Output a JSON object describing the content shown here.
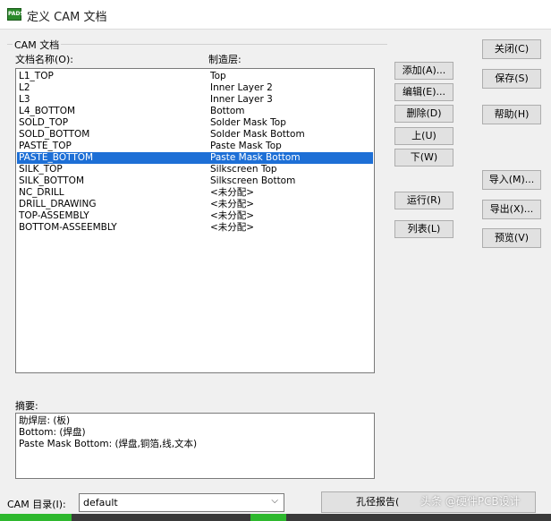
{
  "window": {
    "icon_text": "PADS",
    "title": "定义 CAM 文档"
  },
  "group": {
    "label": "CAM 文档"
  },
  "columns": {
    "name": "文档名称(O):",
    "layer": "制造层:"
  },
  "documents": [
    {
      "name": "L1_TOP",
      "layer": "Top",
      "selected": false
    },
    {
      "name": "L2",
      "layer": "Inner Layer 2",
      "selected": false
    },
    {
      "name": "L3",
      "layer": "Inner Layer 3",
      "selected": false
    },
    {
      "name": "L4_BOTTOM",
      "layer": "Bottom",
      "selected": false
    },
    {
      "name": "SOLD_TOP",
      "layer": "Solder Mask Top",
      "selected": false
    },
    {
      "name": "SOLD_BOTTOM",
      "layer": "Solder Mask Bottom",
      "selected": false
    },
    {
      "name": "PASTE_TOP",
      "layer": "Paste Mask Top",
      "selected": false
    },
    {
      "name": "PASTE_BOTTOM",
      "layer": "Paste Mask Bottom",
      "selected": true
    },
    {
      "name": "SILK_TOP",
      "layer": "Silkscreen Top",
      "selected": false
    },
    {
      "name": "SILK_BOTTOM",
      "layer": "Silkscreen Bottom",
      "selected": false
    },
    {
      "name": "NC_DRILL",
      "layer": "<未分配>",
      "selected": false
    },
    {
      "name": "DRILL_DRAWING",
      "layer": "<未分配>",
      "selected": false
    },
    {
      "name": "TOP-ASSEMBLY",
      "layer": "<未分配>",
      "selected": false
    },
    {
      "name": "BOTTOM-ASSEEMBLY",
      "layer": "<未分配>",
      "selected": false
    }
  ],
  "middle_buttons": {
    "add": "添加(A)...",
    "edit": "编辑(E)...",
    "delete": "删除(D)",
    "up": "上(U)",
    "down": "下(W)",
    "run": "运行(R)",
    "list": "列表(L)"
  },
  "right_buttons": {
    "close": "关闭(C)",
    "save": "保存(S)",
    "help": "帮助(H)",
    "import": "导入(M)...",
    "export": "导出(X)...",
    "preview": "预览(V)"
  },
  "summary": {
    "label": "摘要:",
    "lines": [
      "助焊层: (板)",
      "Bottom: (焊盘)",
      "Paste Mask Bottom: (焊盘,铜箔,线,文本)"
    ]
  },
  "cam_dir": {
    "label": "CAM 目录(I):",
    "value": "default"
  },
  "drill_report_button": "孔径报告(",
  "watermark": "头条 @硬件PCB设计",
  "colors": {
    "selection": "#1d6fd6",
    "title_bg": "#ffffff",
    "dialog_bg": "#f0f0f0",
    "accent_green": "#2eb82e"
  }
}
